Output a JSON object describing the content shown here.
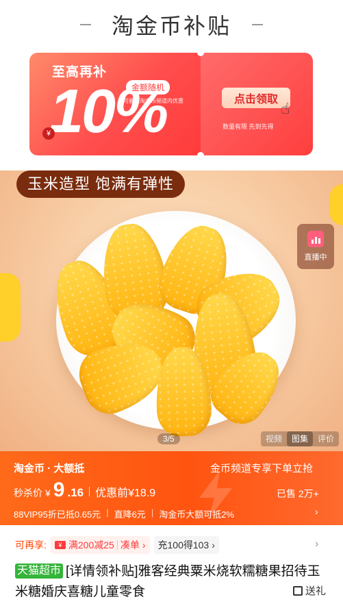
{
  "header": {
    "title": "淘金币补贴"
  },
  "coupon": {
    "headline": "至高再补",
    "rate": "10%",
    "yen_symbol": "¥",
    "tag": "金额随机",
    "subtitle": "可叠加淘金币频道内优惠",
    "button": "点击领取",
    "note": "数量有限 先到先得",
    "colors": {
      "accent": "#ff3b3b",
      "button_bg": "#ffe0cc"
    }
  },
  "gallery": {
    "slogan": "玉米造型 饱满有弹性",
    "live_label": "直播中",
    "page_indicator": "3/5",
    "media_tabs": [
      "视频",
      "图集",
      "评价"
    ],
    "active_media_tab": "图集"
  },
  "price": {
    "brand": "淘金币 · 大额抵",
    "promo": "金币频道专享下单立抢",
    "label": "秒杀价",
    "currency": "¥",
    "price_int": "9",
    "price_dec": ".16",
    "before": "优惠前¥18.9",
    "sold": "已售 2万+",
    "benefits": [
      "88VIP95折已抵0.65元",
      "直降6元",
      "淘金币大额可抵2%"
    ],
    "colors": {
      "banner": "#ff5a14"
    }
  },
  "coupons": {
    "label": "可再享:",
    "items": [
      {
        "text": "满200减25",
        "action": "凑单"
      },
      {
        "text": "充100得103"
      }
    ]
  },
  "product": {
    "badge": "天猫超市",
    "title": "[详情领补贴]雅客经典粟米烧软糯糖果招待玉米糖婚庆喜糖儿童零食",
    "gift_label": "送礼"
  }
}
